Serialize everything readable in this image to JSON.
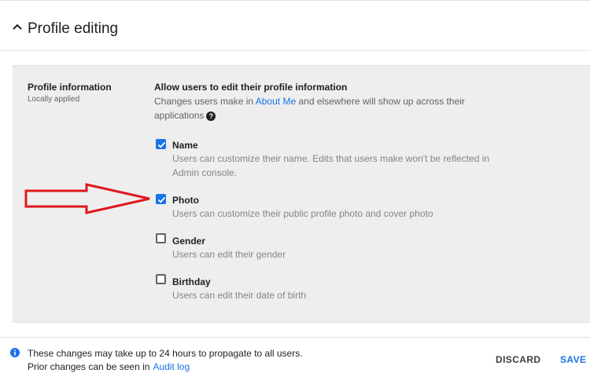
{
  "header": {
    "title": "Profile editing",
    "collapse_icon": "chevron-up-icon"
  },
  "section": {
    "title": "Profile information",
    "subtitle": "Locally applied",
    "group_title": "Allow users to edit their profile information",
    "group_desc_before": "Changes users make in",
    "group_desc_link": "About Me",
    "group_desc_after": "and elsewhere will show up across their applications",
    "help_icon": "help-circle-icon"
  },
  "options": [
    {
      "label": "Name",
      "desc": "Users can customize their name. Edits that users make won't be reflected in Admin console.",
      "checked": true
    },
    {
      "label": "Photo",
      "desc": "Users can customize their public profile photo and cover photo",
      "checked": true
    },
    {
      "label": "Gender",
      "desc": "Users can edit their gender",
      "checked": false
    },
    {
      "label": "Birthday",
      "desc": "Users can edit their date of birth",
      "checked": false
    }
  ],
  "annotation": {
    "icon": "red-arrow-icon",
    "color": "#e0191f"
  },
  "footer": {
    "info_icon": "info-icon",
    "line1": "These changes may take up to 24 hours to propagate to all users.",
    "line2": "Prior changes can be seen in",
    "audit_link": "Audit log",
    "discard_label": "DISCARD",
    "save_label": "SAVE"
  },
  "colors": {
    "accent": "#1a73e8",
    "panel_bg": "#eeeeee"
  }
}
